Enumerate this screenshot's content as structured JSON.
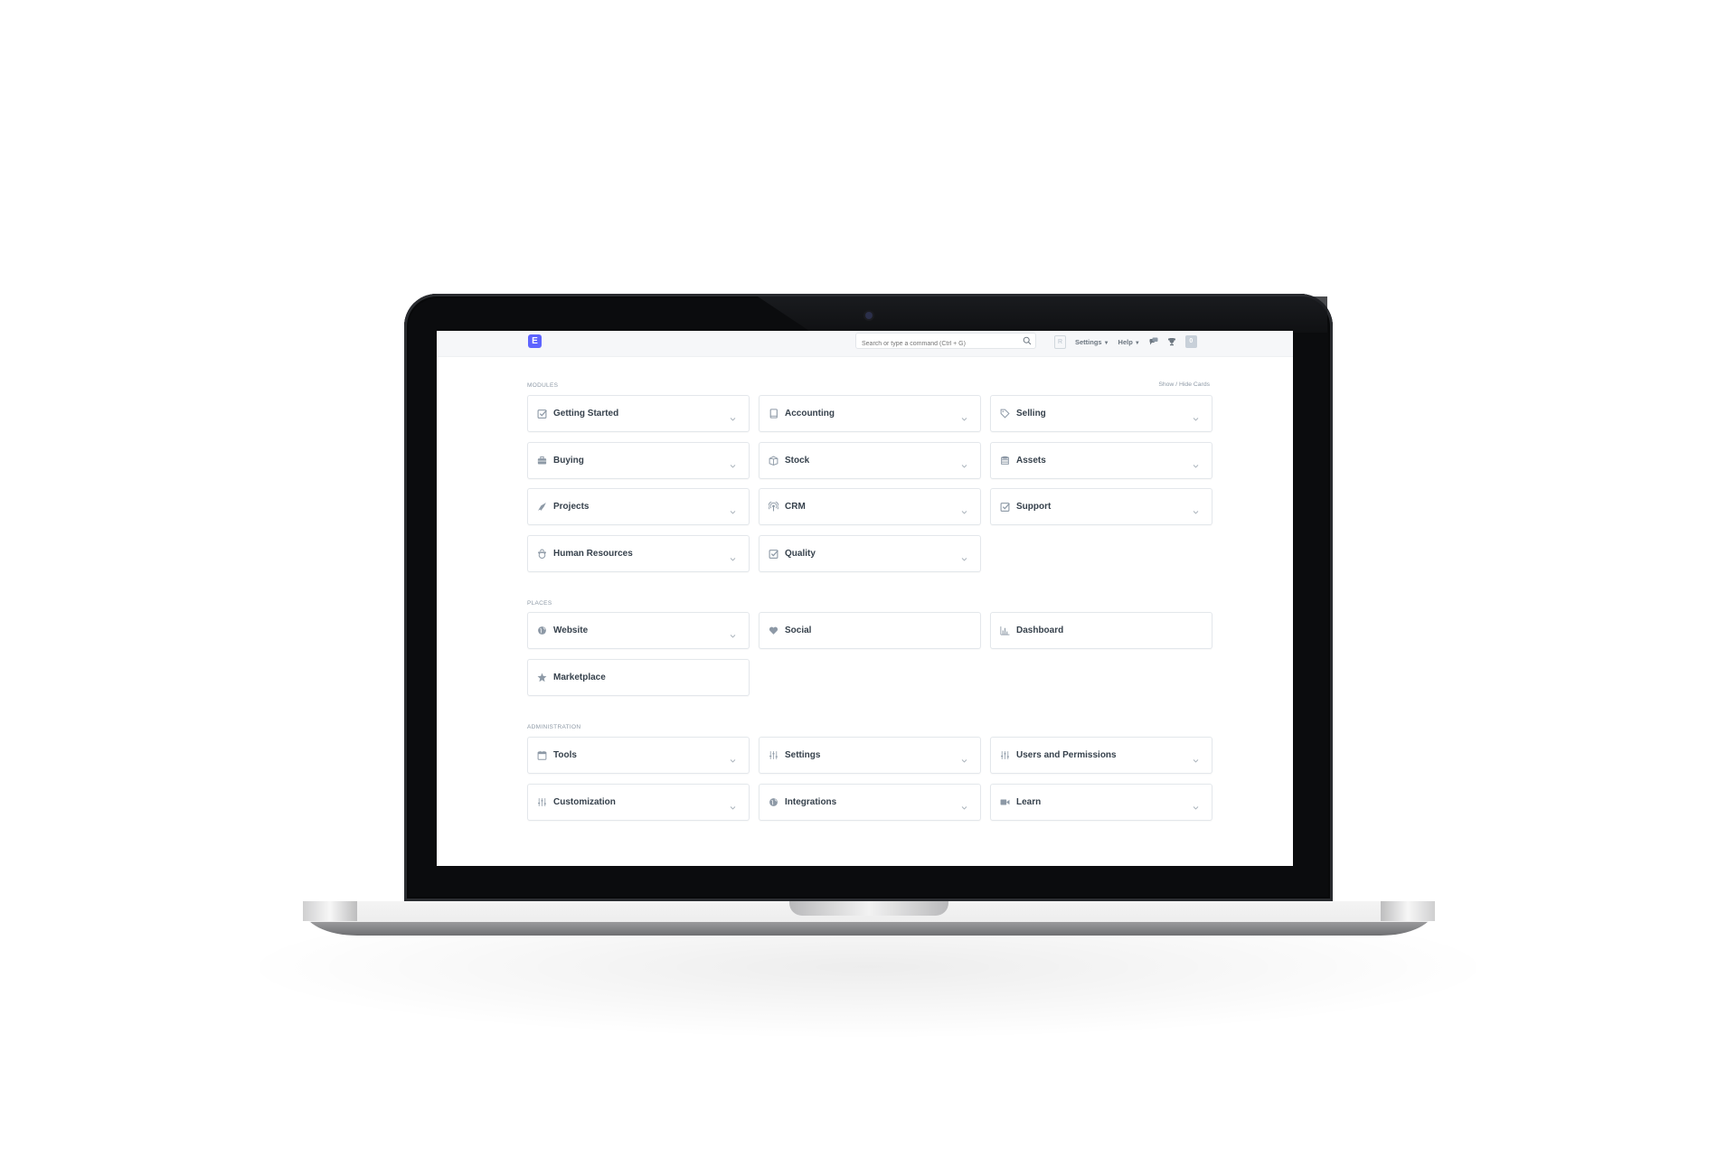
{
  "navbar": {
    "logo_letter": "E",
    "search_placeholder": "Search or type a command (Ctrl + G)",
    "search_icon": "search-icon",
    "user_initial_box": "R",
    "settings_label": "Settings",
    "help_label": "Help",
    "notifications_icon": "chat-bubbles-icon",
    "achievements_icon": "trophy-icon",
    "avatar_letter": "0"
  },
  "modules": {
    "label": "MODULES",
    "show_hide": "Show / Hide Cards",
    "cards": [
      {
        "label": "Getting Started",
        "icon": "checkbox-icon",
        "has_dropdown": true
      },
      {
        "label": "Accounting",
        "icon": "book-icon",
        "has_dropdown": true
      },
      {
        "label": "Selling",
        "icon": "tag-icon",
        "has_dropdown": true
      },
      {
        "label": "Buying",
        "icon": "briefcase-icon",
        "has_dropdown": true
      },
      {
        "label": "Stock",
        "icon": "box-icon",
        "has_dropdown": true
      },
      {
        "label": "Assets",
        "icon": "database-icon",
        "has_dropdown": true
      },
      {
        "label": "Projects",
        "icon": "rocket-icon",
        "has_dropdown": true
      },
      {
        "label": "CRM",
        "icon": "broadcast-icon",
        "has_dropdown": true
      },
      {
        "label": "Support",
        "icon": "checkbox-icon",
        "has_dropdown": true
      },
      {
        "label": "Human Resources",
        "icon": "people-icon",
        "has_dropdown": true
      },
      {
        "label": "Quality",
        "icon": "checkbox-icon",
        "has_dropdown": true
      }
    ]
  },
  "places": {
    "label": "PLACES",
    "cards": [
      {
        "label": "Website",
        "icon": "globe-icon",
        "has_dropdown": true
      },
      {
        "label": "Social",
        "icon": "heart-icon",
        "has_dropdown": false
      },
      {
        "label": "Dashboard",
        "icon": "bar-chart-icon",
        "has_dropdown": false
      },
      {
        "label": "Marketplace",
        "icon": "star-icon",
        "has_dropdown": false
      }
    ]
  },
  "administration": {
    "label": "ADMINISTRATION",
    "cards": [
      {
        "label": "Tools",
        "icon": "calendar-icon",
        "has_dropdown": true
      },
      {
        "label": "Settings",
        "icon": "sliders-icon",
        "has_dropdown": true
      },
      {
        "label": "Users and Permissions",
        "icon": "sliders-icon",
        "has_dropdown": true
      },
      {
        "label": "Customization",
        "icon": "sliders-icon",
        "has_dropdown": true
      },
      {
        "label": "Integrations",
        "icon": "globe-icon",
        "has_dropdown": true
      },
      {
        "label": "Learn",
        "icon": "video-camera-icon",
        "has_dropdown": true
      }
    ]
  },
  "colors": {
    "brand": "#5e64ff",
    "text": "#36414c",
    "muted": "#8d99a6",
    "border": "#e3e7eb",
    "navbar_bg": "#f6f7f9"
  }
}
